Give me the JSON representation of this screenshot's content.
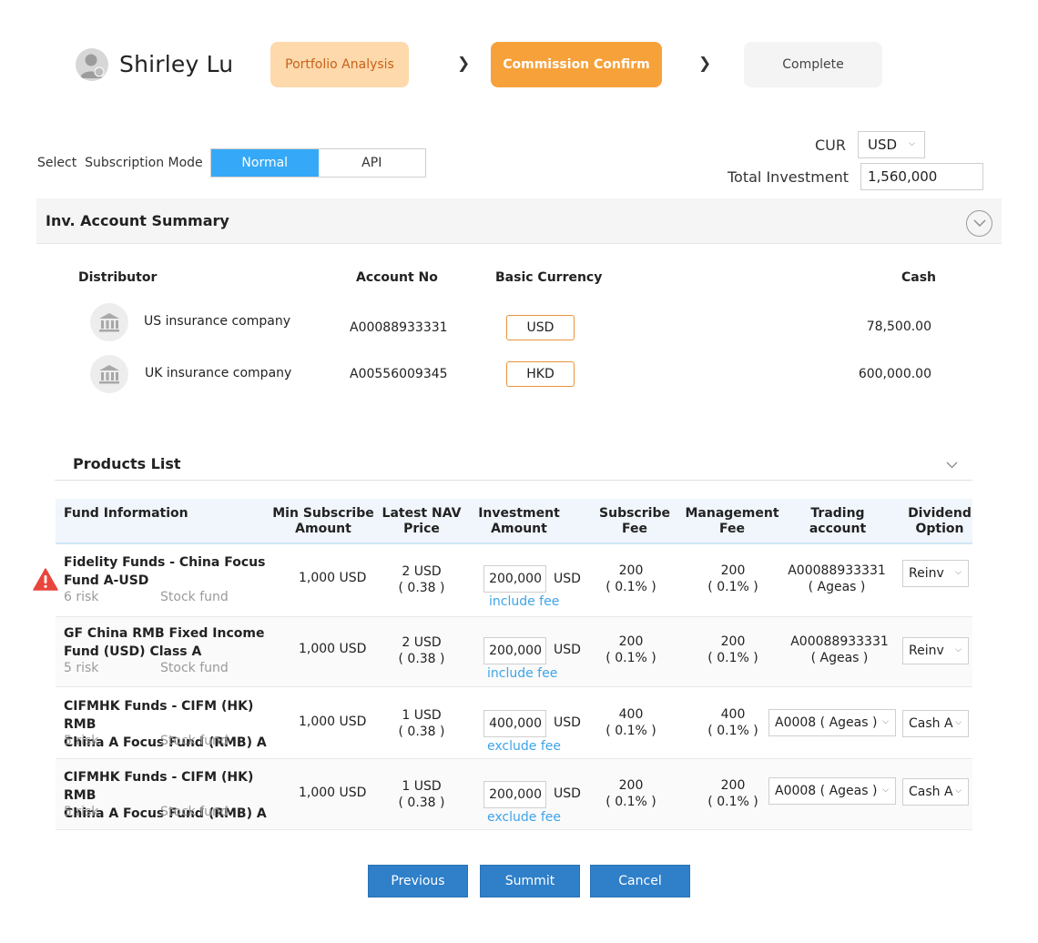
{
  "header": {
    "user_name": "Shirley Lu",
    "steps": [
      {
        "label": "Portfolio Analysis"
      },
      {
        "label": "Commission Confirm"
      },
      {
        "label": "Complete"
      }
    ],
    "step_separator": "❯"
  },
  "subscription": {
    "label": "Select  Subscription Mode",
    "modes": [
      "Normal",
      "API"
    ],
    "selected": "Normal"
  },
  "currency": {
    "label": "CUR",
    "value": "USD"
  },
  "total_investment": {
    "label": "Total Investment",
    "value": "1,560,000"
  },
  "account_summary": {
    "title": "Inv. Account Summary",
    "columns": {
      "distributor": "Distributor",
      "account_no": "Account No",
      "basic_currency": "Basic Currency",
      "cash": "Cash"
    },
    "rows": [
      {
        "distributor": "US insurance company",
        "account_no": "A00088933331",
        "currency": "USD",
        "cash": "78,500.00"
      },
      {
        "distributor": "UK insurance company",
        "account_no": "A00556009345",
        "currency": "HKD",
        "cash": "600,000.00"
      }
    ]
  },
  "products": {
    "title": "Products List",
    "columns": {
      "fund_info": "Fund Information",
      "min_sub_1": "Min Subscribe",
      "min_sub_2": "Amount",
      "nav_1": "Latest NAV",
      "nav_2": "Price",
      "inv_1": "Investment",
      "inv_2": "Amount",
      "sub_fee_1": "Subscribe",
      "sub_fee_2": "Fee",
      "mgmt_fee_1": "Management",
      "mgmt_fee_2": "Fee",
      "trading": "Trading account",
      "div_1": "Dividend",
      "div_2": "Option"
    },
    "rows": [
      {
        "name_1": "Fidelity Funds - China Focus",
        "name_2": "Fund A-USD",
        "risk": "6 risk",
        "type": "Stock fund",
        "min_sub": "1,000 USD",
        "nav": "2 USD",
        "nav_sub": "( 0.38 )",
        "amount": "200,000",
        "unit": "USD",
        "fee_mode": "include fee",
        "sub_fee": "200",
        "sub_fee_pct": "( 0.1% )",
        "mgmt_fee": "200",
        "mgmt_fee_pct": "( 0.1% )",
        "trading_1": "A00088933331",
        "trading_2": "( Ageas )",
        "dividend": "Reinv",
        "warning": true
      },
      {
        "name_1": "GF China RMB Fixed Income",
        "name_2": "Fund (USD) Class A",
        "risk": "5 risk",
        "type": "Stock fund",
        "min_sub": "1,000 USD",
        "nav": "2 USD",
        "nav_sub": "( 0.38 )",
        "amount": "200,000",
        "unit": "USD",
        "fee_mode": "include fee",
        "sub_fee": "200",
        "sub_fee_pct": "( 0.1% )",
        "mgmt_fee": "200",
        "mgmt_fee_pct": "( 0.1% )",
        "trading_1": "A00088933331",
        "trading_2": "( Ageas )",
        "dividend": "Reinv"
      },
      {
        "name_1": "CIFMHK Funds - CIFM (HK) RMB",
        "name_2": "China A Focus Fund (RMB) A",
        "risk": "5 risk",
        "type": "Stock fund",
        "min_sub": "1,000 USD",
        "nav": "1 USD",
        "nav_sub": "( 0.38 )",
        "amount": "400,000",
        "unit": "USD",
        "fee_mode": "exclude fee",
        "sub_fee": "400",
        "sub_fee_pct": "( 0.1% )",
        "mgmt_fee": "400",
        "mgmt_fee_pct": "( 0.1% )",
        "trading_select": "A0008 ( Ageas )",
        "dividend": "Cash A"
      },
      {
        "name_1": "CIFMHK Funds - CIFM (HK) RMB",
        "name_2": "China A Focus Fund (RMB) A",
        "risk": "5 risk",
        "type": "Stock fund",
        "min_sub": "1,000 USD",
        "nav": "1 USD",
        "nav_sub": "( 0.38 )",
        "amount": "200,000",
        "unit": "USD",
        "fee_mode": "exclude fee",
        "sub_fee": "200",
        "sub_fee_pct": "( 0.1% )",
        "mgmt_fee": "200",
        "mgmt_fee_pct": "( 0.1% )",
        "trading_select": "A0008 ( Ageas )",
        "dividend": "Cash A"
      }
    ]
  },
  "actions": {
    "previous": "Previous",
    "submit": "Summit",
    "cancel": "Cancel"
  },
  "colors": {
    "accent_blue": "#35a9f7",
    "button_blue": "#2f7fc9",
    "orange": "#f7a13b",
    "light_orange": "#fdd9ab",
    "warning_red": "#e8453c",
    "link_blue": "#3ea4e8"
  },
  "icons": {
    "avatar": "user-avatar-icon",
    "distributor": "bank-icon",
    "collapse": "chevron-down-circle-icon",
    "warning": "warning-triangle-icon",
    "dropdown": "caret-down-icon"
  }
}
